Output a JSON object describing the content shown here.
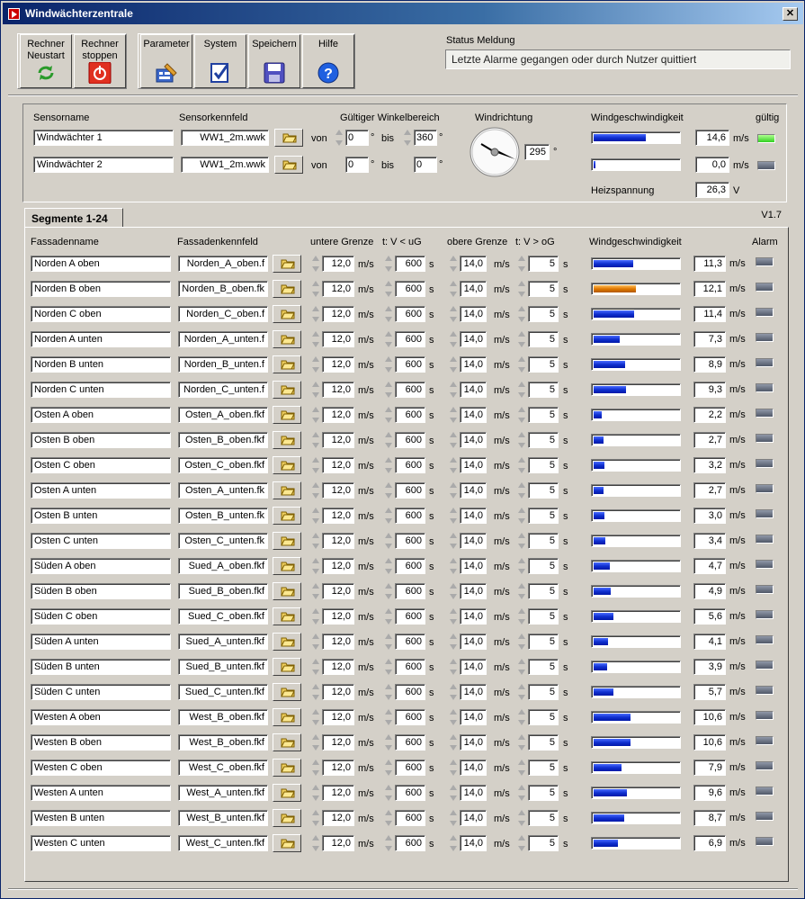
{
  "window": {
    "title": "Windwächterzentrale",
    "close": "✕"
  },
  "toolbar": {
    "restart": "Rechner Neustart",
    "stop": "Rechner stoppen",
    "parameter": "Parameter",
    "system": "System",
    "save": "Speichern",
    "help": "Hilfe"
  },
  "status": {
    "label": "Status Meldung",
    "message": "Letzte Alarme gegangen oder durch Nutzer quittiert"
  },
  "sensor_panel": {
    "headers": {
      "name": "Sensorname",
      "file": "Sensorkennfeld",
      "range": "Gültiger Winkelbereich",
      "direction": "Windrichtung",
      "speed": "Windgeschwindigkeit",
      "valid": "gültig"
    },
    "von": "von",
    "bis": "bis",
    "deg": "°",
    "unit": "m/s",
    "sensors": [
      {
        "name": "Windwächter 1",
        "file": "WW1_2m.wwk",
        "from": "0",
        "to": "360",
        "speed": "14,6",
        "speed_fraction": 0.6,
        "valid": true
      },
      {
        "name": "Windwächter 2",
        "file": "WW1_2m.wwk",
        "from": "0",
        "to": "0",
        "speed": "0,0",
        "speed_fraction": 0.02,
        "valid": false
      }
    ],
    "direction_value": "295",
    "heating_label": "Heizspannung",
    "heating_value": "26,3",
    "heating_unit": "V"
  },
  "tabs": {
    "segments": "Segmente 1-24",
    "version": "V1.7"
  },
  "segments": {
    "headers": {
      "name": "Fassadenname",
      "file": "Fassadenkennfeld",
      "lower": "untere Grenze",
      "t_lower": "t: V < uG",
      "upper": "obere Grenze",
      "t_upper": "t: V > oG",
      "speed": "Windgeschwindigkeit",
      "alarm": "Alarm"
    },
    "unit_ms": "m/s",
    "unit_s": "s",
    "rows": [
      {
        "name": "Norden A oben",
        "file": "Norden_A_oben.f",
        "lower": "12,0",
        "tl": "600",
        "upper": "14,0",
        "tu": "5",
        "speed": "11,3",
        "frac": 0.46,
        "warn": false
      },
      {
        "name": "Norden B oben",
        "file": "Norden_B_oben.fk",
        "lower": "12,0",
        "tl": "600",
        "upper": "14,0",
        "tu": "5",
        "speed": "12,1",
        "frac": 0.49,
        "warn": true
      },
      {
        "name": "Norden C oben",
        "file": "Norden_C_oben.f",
        "lower": "12,0",
        "tl": "600",
        "upper": "14,0",
        "tu": "5",
        "speed": "11,4",
        "frac": 0.47,
        "warn": false
      },
      {
        "name": "Norden A unten",
        "file": "Norden_A_unten.f",
        "lower": "12,0",
        "tl": "600",
        "upper": "14,0",
        "tu": "5",
        "speed": "7,3",
        "frac": 0.3,
        "warn": false
      },
      {
        "name": "Norden B unten",
        "file": "Norden_B_unten.f",
        "lower": "12,0",
        "tl": "600",
        "upper": "14,0",
        "tu": "5",
        "speed": "8,9",
        "frac": 0.36,
        "warn": false
      },
      {
        "name": "Norden C unten",
        "file": "Norden_C_unten.f",
        "lower": "12,0",
        "tl": "600",
        "upper": "14,0",
        "tu": "5",
        "speed": "9,3",
        "frac": 0.38,
        "warn": false
      },
      {
        "name": "Osten A oben",
        "file": "Osten_A_oben.fkf",
        "lower": "12,0",
        "tl": "600",
        "upper": "14,0",
        "tu": "5",
        "speed": "2,2",
        "frac": 0.09,
        "warn": false
      },
      {
        "name": "Osten B oben",
        "file": "Osten_B_oben.fkf",
        "lower": "12,0",
        "tl": "600",
        "upper": "14,0",
        "tu": "5",
        "speed": "2,7",
        "frac": 0.11,
        "warn": false
      },
      {
        "name": "Osten C oben",
        "file": "Osten_C_oben.fkf",
        "lower": "12,0",
        "tl": "600",
        "upper": "14,0",
        "tu": "5",
        "speed": "3,2",
        "frac": 0.13,
        "warn": false
      },
      {
        "name": "Osten A unten",
        "file": "Osten_A_unten.fk",
        "lower": "12,0",
        "tl": "600",
        "upper": "14,0",
        "tu": "5",
        "speed": "2,7",
        "frac": 0.11,
        "warn": false
      },
      {
        "name": "Osten B unten",
        "file": "Osten_B_unten.fk",
        "lower": "12,0",
        "tl": "600",
        "upper": "14,0",
        "tu": "5",
        "speed": "3,0",
        "frac": 0.12,
        "warn": false
      },
      {
        "name": "Osten C unten",
        "file": "Osten_C_unten.fk",
        "lower": "12,0",
        "tl": "600",
        "upper": "14,0",
        "tu": "5",
        "speed": "3,4",
        "frac": 0.14,
        "warn": false
      },
      {
        "name": "Süden A oben",
        "file": "Sued_A_oben.fkf",
        "lower": "12,0",
        "tl": "600",
        "upper": "14,0",
        "tu": "5",
        "speed": "4,7",
        "frac": 0.19,
        "warn": false
      },
      {
        "name": "Süden B oben",
        "file": "Sued_B_oben.fkf",
        "lower": "12,0",
        "tl": "600",
        "upper": "14,0",
        "tu": "5",
        "speed": "4,9",
        "frac": 0.2,
        "warn": false
      },
      {
        "name": "Süden C oben",
        "file": "Sued_C_oben.fkf",
        "lower": "12,0",
        "tl": "600",
        "upper": "14,0",
        "tu": "5",
        "speed": "5,6",
        "frac": 0.23,
        "warn": false
      },
      {
        "name": "Süden A unten",
        "file": "Sued_A_unten.fkf",
        "lower": "12,0",
        "tl": "600",
        "upper": "14,0",
        "tu": "5",
        "speed": "4,1",
        "frac": 0.17,
        "warn": false
      },
      {
        "name": "Süden B unten",
        "file": "Sued_B_unten.fkf",
        "lower": "12,0",
        "tl": "600",
        "upper": "14,0",
        "tu": "5",
        "speed": "3,9",
        "frac": 0.16,
        "warn": false
      },
      {
        "name": "Süden C unten",
        "file": "Sued_C_unten.fkf",
        "lower": "12,0",
        "tl": "600",
        "upper": "14,0",
        "tu": "5",
        "speed": "5,7",
        "frac": 0.23,
        "warn": false
      },
      {
        "name": "Westen A oben",
        "file": "West_B_oben.fkf",
        "lower": "12,0",
        "tl": "600",
        "upper": "14,0",
        "tu": "5",
        "speed": "10,6",
        "frac": 0.43,
        "warn": false
      },
      {
        "name": "Westen B oben",
        "file": "West_B_oben.fkf",
        "lower": "12,0",
        "tl": "600",
        "upper": "14,0",
        "tu": "5",
        "speed": "10,6",
        "frac": 0.43,
        "warn": false
      },
      {
        "name": "Westen C oben",
        "file": "West_C_oben.fkf",
        "lower": "12,0",
        "tl": "600",
        "upper": "14,0",
        "tu": "5",
        "speed": "7,9",
        "frac": 0.32,
        "warn": false
      },
      {
        "name": "Westen A unten",
        "file": "West_A_unten.fkf",
        "lower": "12,0",
        "tl": "600",
        "upper": "14,0",
        "tu": "5",
        "speed": "9,6",
        "frac": 0.39,
        "warn": false
      },
      {
        "name": "Westen B unten",
        "file": "West_B_unten.fkf",
        "lower": "12,0",
        "tl": "600",
        "upper": "14,0",
        "tu": "5",
        "speed": "8,7",
        "frac": 0.35,
        "warn": false
      },
      {
        "name": "Westen C unten",
        "file": "West_C_unten.fkf",
        "lower": "12,0",
        "tl": "600",
        "upper": "14,0",
        "tu": "5",
        "speed": "6,9",
        "frac": 0.28,
        "warn": false
      }
    ]
  },
  "colors": {
    "bar": "#1030d0",
    "bar_warn": "#e07800",
    "led_on": "#30d020",
    "led_off": "#505868",
    "titlebar": "#0a246a"
  }
}
